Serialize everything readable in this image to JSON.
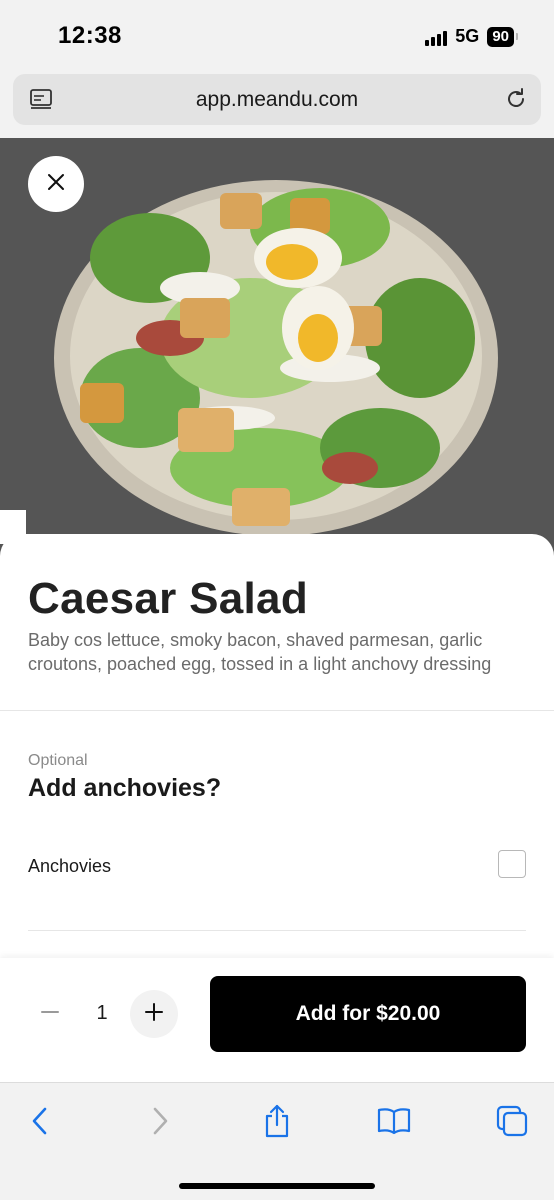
{
  "status_bar": {
    "time": "12:38",
    "network": "5G",
    "battery": "90"
  },
  "browser": {
    "url": "app.meandu.com",
    "icons": [
      "reader-icon",
      "reload-icon"
    ]
  },
  "hero": {
    "image_alt": "Caesar salad in a bowl",
    "close_icon": "close-icon"
  },
  "dish": {
    "title": "Caesar Salad",
    "description": "Baby cos lettuce, smoky bacon, shaved parmesan, garlic croutons, poached egg, tossed in a light anchovy dressing"
  },
  "modifier": {
    "tag": "Optional",
    "title": "Add anchovies?",
    "options": [
      {
        "label": "Anchovies",
        "checked": false
      }
    ]
  },
  "order": {
    "quantity": "1",
    "add_label": "Add for $20.00"
  },
  "toolbar": {
    "items": [
      "back-icon",
      "forward-icon",
      "share-icon",
      "bookmarks-icon",
      "tabs-icon"
    ]
  },
  "colors": {
    "accent": "#1a73e8",
    "primary_button": "#000000",
    "hero_bg": "#555555"
  }
}
